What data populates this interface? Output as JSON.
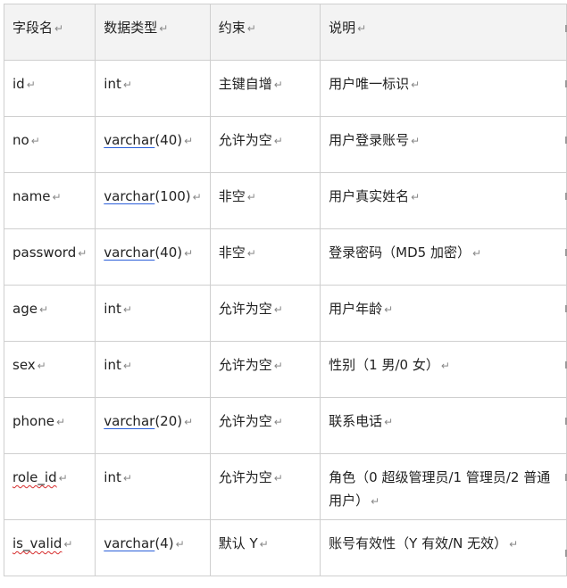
{
  "table": {
    "headers": [
      "字段名",
      "数据类型",
      "约束",
      "说明"
    ],
    "rows": [
      {
        "field": "id",
        "type": "int",
        "constraint": "主键自增",
        "desc": "用户唯一标识"
      },
      {
        "field": "no",
        "type_name": "varchar",
        "type_arg": "(40)",
        "constraint": "允许为空",
        "desc": "用户登录账号"
      },
      {
        "field": "name",
        "type_name": "varchar",
        "type_arg": "(100)",
        "constraint": "非空",
        "desc": "用户真实姓名"
      },
      {
        "field": "password",
        "type_name": "varchar",
        "type_arg": "(40)",
        "constraint": "非空",
        "desc": "登录密码（MD5 加密）"
      },
      {
        "field": "age",
        "type": "int",
        "constraint": "允许为空",
        "desc": "用户年龄"
      },
      {
        "field": "sex",
        "type": "int",
        "constraint": "允许为空",
        "desc": "性别（1 男/0 女）"
      },
      {
        "field": "phone",
        "type_name": "varchar",
        "type_arg": "(20)",
        "constraint": "允许为空",
        "desc": "联系电话"
      },
      {
        "field": "role_id",
        "type": "int",
        "constraint": "允许为空",
        "desc": "角色（0 超级管理员/1 管理员/2 普通用户）"
      },
      {
        "field": "is_valid",
        "type_name": "varchar",
        "type_arg": "(4)",
        "constraint": "默认 Y",
        "desc": "账号有效性（Y 有效/N 无效）"
      }
    ]
  },
  "paragraph_mark": "↵"
}
